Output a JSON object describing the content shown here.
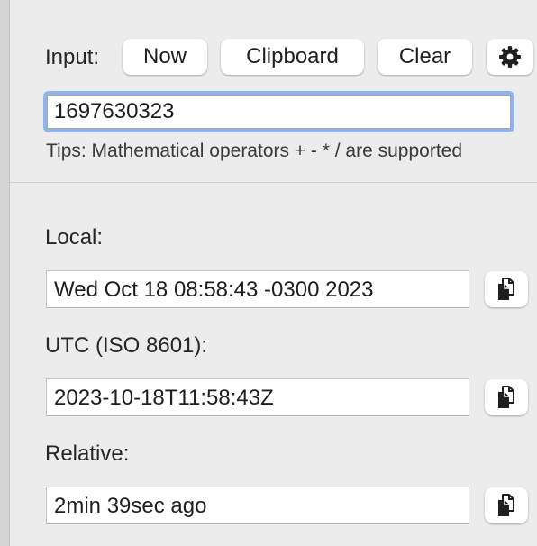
{
  "input_section": {
    "label": "Input:",
    "buttons": {
      "now": "Now",
      "clipboard": "Clipboard",
      "clear": "Clear"
    },
    "value": "1697630323",
    "tips": "Tips: Mathematical operators + - * / are supported"
  },
  "results": {
    "local": {
      "label": "Local:",
      "value": "Wed Oct 18 08:58:43 -0300 2023"
    },
    "utc": {
      "label": "UTC (ISO 8601):",
      "value": "2023-10-18T11:58:43Z"
    },
    "relative": {
      "label": "Relative:",
      "value": "2min 39sec ago"
    }
  },
  "icons": {
    "settings": "gear-icon",
    "copy": "copy-icon"
  },
  "colors": {
    "background": "#ececec",
    "focus_ring": "#8fb3ef",
    "button_bg": "#ffffff",
    "text": "#262626"
  }
}
